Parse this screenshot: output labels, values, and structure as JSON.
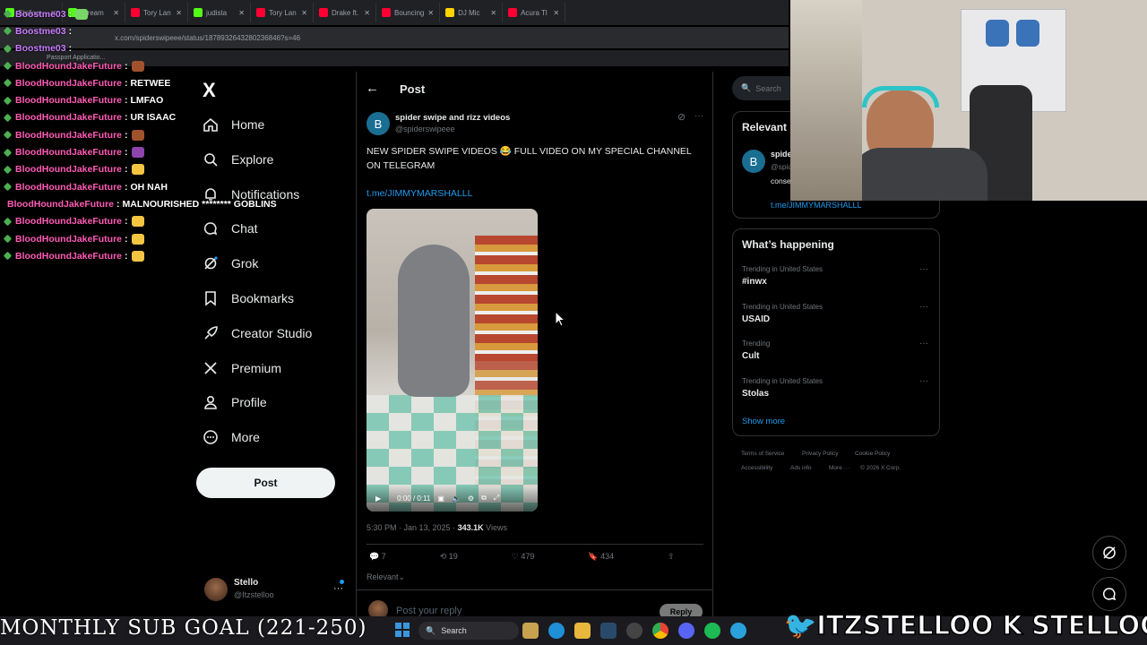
{
  "browser": {
    "tabs": [
      {
        "label": "Stelloo",
        "color": "#53fc18"
      },
      {
        "label": "Stream",
        "color": "#53fc18"
      },
      {
        "label": "Tory Lan",
        "color": "#ff0033"
      },
      {
        "label": "judista",
        "color": "#53fc18"
      },
      {
        "label": "Tory Lan",
        "color": "#ff0033"
      },
      {
        "label": "Drake ft.",
        "color": "#ff0033"
      },
      {
        "label": "Bouncing",
        "color": "#ff0033"
      },
      {
        "label": "DJ Mic",
        "color": "#ffd400"
      },
      {
        "label": "Acura Tl",
        "color": "#ff0033"
      }
    ],
    "url": "x.com/spiderswipeee/status/1878932643280236846?s=46",
    "bookmark": "Passport Applicatio..."
  },
  "chat": {
    "lines": [
      {
        "user": "Boostme03",
        "msg": "",
        "emote": "#7bd66a",
        "alt": true
      },
      {
        "user": "Boostme03",
        "msg": "",
        "emote": "",
        "alt": true
      },
      {
        "user": "Boostme03",
        "msg": "",
        "emote": "",
        "alt": true
      },
      {
        "user": "BloodHoundJakeFuture",
        "msg": "",
        "emote": "#a0522d"
      },
      {
        "user": "BloodHoundJakeFuture",
        "msg": "RETWEE",
        "emote": ""
      },
      {
        "user": "BloodHoundJakeFuture",
        "msg": "LMFAO",
        "emote": ""
      },
      {
        "user": "BloodHoundJakeFuture",
        "msg": "UR ISAAC",
        "emote": ""
      },
      {
        "user": "BloodHoundJakeFuture",
        "msg": "",
        "emote": "#a0522d"
      },
      {
        "user": "BloodHoundJakeFuture",
        "msg": "",
        "emote": "#8e44ad"
      },
      {
        "user": "BloodHoundJakeFuture",
        "msg": "",
        "emote": "#f5c542"
      },
      {
        "user": "BloodHoundJakeFuture",
        "msg": "OH NAH",
        "emote": ""
      },
      {
        "user": "BloodHoundJakeFuture",
        "msg": "MALNOURISHED ******** GOBLINS",
        "emote": ""
      },
      {
        "user": "BloodHoundJakeFuture",
        "msg": "",
        "emote": "#f5c542"
      },
      {
        "user": "BloodHoundJakeFuture",
        "msg": "",
        "emote": "#f5c542"
      },
      {
        "user": "BloodHoundJakeFuture",
        "msg": "",
        "emote": "#f5c542"
      }
    ]
  },
  "nav": {
    "logo": "X",
    "items": [
      "Home",
      "Explore",
      "Notifications",
      "Chat",
      "Grok",
      "Bookmarks",
      "Creator Studio",
      "Premium",
      "Profile",
      "More"
    ],
    "post_button": "Post",
    "account": {
      "name": "Stello",
      "handle": "@Itzstelloo"
    }
  },
  "main": {
    "header": "Post",
    "author": {
      "name": "spider swipe and rizz videos",
      "handle": "@spiderswipeee",
      "avatar_letter": "B"
    },
    "text": "NEW SPIDER SWIPE VIDEOS 😂 FULL VIDEO ON MY SPECIAL CHANNEL ON TELEGRAM",
    "link": "t.me/JIMMYMARSHALLL",
    "video_time": "0:00 / 0:11",
    "timestamp": "5:30 PM · Jan 13, 2025 · ",
    "views": "343.1K",
    "views_label": "Views",
    "stats": {
      "replies": "7",
      "reposts": "19",
      "likes": "479",
      "bookmarks": "434"
    },
    "sort": "Relevant",
    "reply_placeholder": "Post your reply",
    "reply_button": "Reply"
  },
  "right": {
    "search": "Search",
    "relevant": {
      "title": "Relevant people",
      "avatar_letter": "B",
      "name": "spider swipe and rizz videos",
      "handle": "@spiderswipeee",
      "bio": "consent... swipe...",
      "link": "t.me/JIMMYMARSHALLL"
    },
    "happening": {
      "title": "What’s happening",
      "trends": [
        {
          "context": "Trending in United States",
          "name": "#inwx"
        },
        {
          "context": "Trending in United States",
          "name": "USAID"
        },
        {
          "context": "Trending",
          "name": "Cult"
        },
        {
          "context": "Trending in United States",
          "name": "Stolas"
        }
      ],
      "show_more": "Show more"
    },
    "footer": {
      "terms": "Terms of Service",
      "privacy": "Privacy Policy",
      "cookie": "Cookie Policy",
      "access": "Accessibility",
      "ads": "Ads info",
      "more": "More ···",
      "copy": "© 2026 X Corp."
    }
  },
  "overlay": {
    "goal": "MONTHLY SUB GOAL (221-250)",
    "handles": "🐦ITZSTELLOO  K STELLOOO"
  },
  "taskbar": {
    "search": "Search"
  }
}
